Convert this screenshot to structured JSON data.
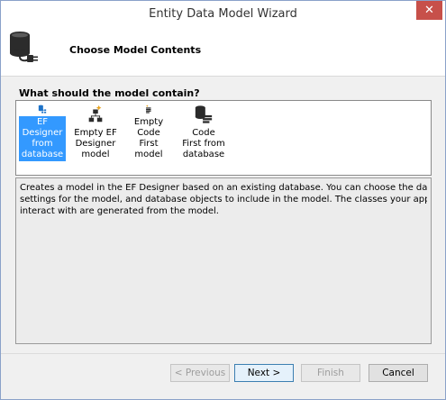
{
  "window": {
    "title": "Entity Data Model Wizard",
    "close_glyph": "✕"
  },
  "header": {
    "title": "Choose Model Contents",
    "icon": "database-plug-icon"
  },
  "question": "What should the model contain?",
  "choices": [
    {
      "label": "EF Designer from database",
      "icon": "database-designer-icon",
      "selected": true
    },
    {
      "label": "Empty EF Designer model",
      "icon": "designer-sparkle-icon",
      "selected": false
    },
    {
      "label": "Empty Code First model",
      "icon": "code-first-sparkle-icon",
      "selected": false
    },
    {
      "label": "Code First from database",
      "icon": "code-first-database-icon",
      "selected": false
    }
  ],
  "description_lines": [
    "Creates a model in the EF Designer based on an existing database. You can choose the database connection,",
    "settings for the model, and database objects to include in the model. The classes your application will",
    "interact with are generated from the model."
  ],
  "buttons": {
    "previous": "< Previous",
    "next": "Next >",
    "finish": "Finish",
    "cancel": "Cancel"
  },
  "colors": {
    "selection": "#3399ff",
    "close_button": "#c7504a"
  }
}
